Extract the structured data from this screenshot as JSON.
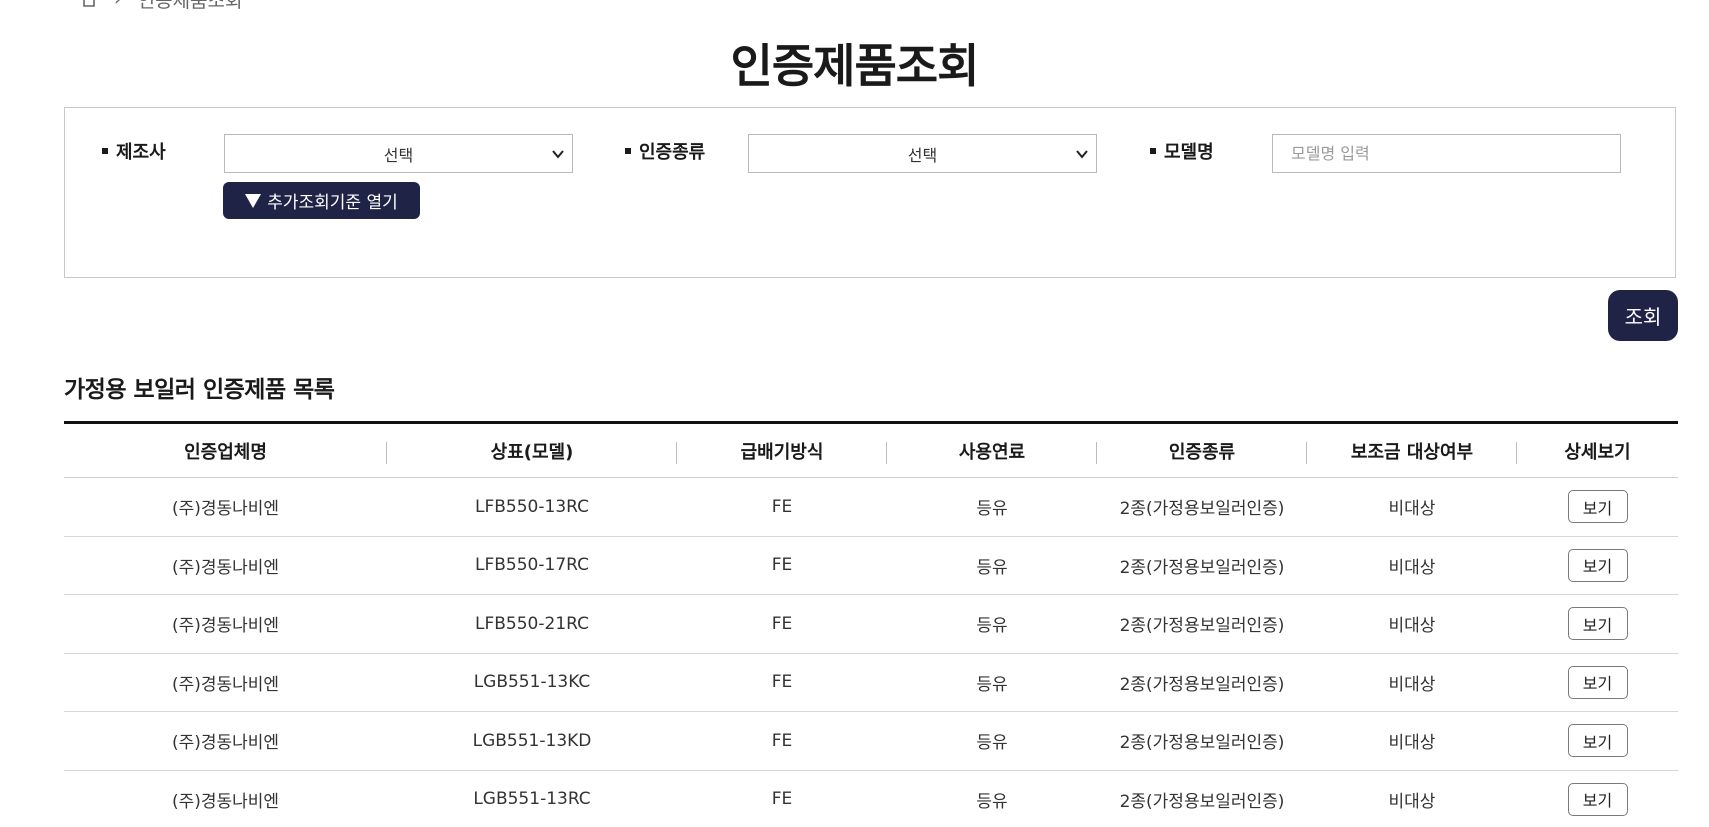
{
  "breadcrumb": {
    "current": "인증제품조회"
  },
  "page": {
    "title": "인증제품조회"
  },
  "search": {
    "manufacturer_label": "제조사",
    "manufacturer_value": "선택",
    "cert_type_label": "인증종류",
    "cert_type_value": "선택",
    "model_label": "모델명",
    "model_placeholder": "모델명 입력",
    "more_button": "추가조회기준 열기",
    "search_button": "조회"
  },
  "list": {
    "title": "가정용 보일러 인증제품 목록",
    "columns": [
      "인증업체명",
      "상표(모델)",
      "급배기방식",
      "사용연료",
      "인증종류",
      "보조금 대상여부",
      "상세보기"
    ],
    "rows": [
      {
        "company": "(주)경동나비엔",
        "model": "LFB550-13RC",
        "exhaust": "FE",
        "fuel": "등유",
        "cert": "2종(가정용보일러인증)",
        "subsidy": "비대상",
        "action": "보기"
      },
      {
        "company": "(주)경동나비엔",
        "model": "LFB550-17RC",
        "exhaust": "FE",
        "fuel": "등유",
        "cert": "2종(가정용보일러인증)",
        "subsidy": "비대상",
        "action": "보기"
      },
      {
        "company": "(주)경동나비엔",
        "model": "LFB550-21RC",
        "exhaust": "FE",
        "fuel": "등유",
        "cert": "2종(가정용보일러인증)",
        "subsidy": "비대상",
        "action": "보기"
      },
      {
        "company": "(주)경동나비엔",
        "model": "LGB551-13KC",
        "exhaust": "FE",
        "fuel": "등유",
        "cert": "2종(가정용보일러인증)",
        "subsidy": "비대상",
        "action": "보기"
      },
      {
        "company": "(주)경동나비엔",
        "model": "LGB551-13KD",
        "exhaust": "FE",
        "fuel": "등유",
        "cert": "2종(가정용보일러인증)",
        "subsidy": "비대상",
        "action": "보기"
      },
      {
        "company": "(주)경동나비엔",
        "model": "LGB551-13RC",
        "exhaust": "FE",
        "fuel": "등유",
        "cert": "2종(가정용보일러인증)",
        "subsidy": "비대상",
        "action": "보기"
      }
    ]
  }
}
